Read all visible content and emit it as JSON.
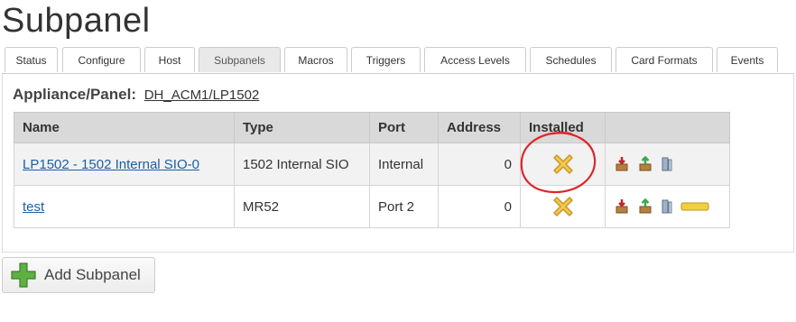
{
  "page": {
    "title": "Subpanel"
  },
  "tabs": [
    "Status",
    "Configure",
    "Host",
    "Subpanels",
    "Macros",
    "Triggers",
    "Access Levels",
    "Schedules",
    "Card Formats",
    "Events"
  ],
  "active_tab": "Subpanels",
  "appliance": {
    "label": "Appliance/Panel:",
    "value": "DH_ACM1/LP1502"
  },
  "table": {
    "headers": [
      "Name",
      "Type",
      "Port",
      "Address",
      "Installed",
      ""
    ],
    "rows": [
      {
        "name": "LP1502 - 1502 Internal SIO-0",
        "type": "1502 Internal SIO",
        "port": "Internal",
        "address": "0",
        "installed": "x-icon"
      },
      {
        "name": "test",
        "type": "MR52",
        "port": "Port 2",
        "address": "0",
        "installed": "x-icon"
      }
    ]
  },
  "add_button": {
    "label": "Add Subpanel"
  },
  "colors": {
    "link": "#1a5fa8",
    "header_bg": "#d9d9d9",
    "annotation": "#e0242b",
    "x_icon": "#f2c94c"
  }
}
